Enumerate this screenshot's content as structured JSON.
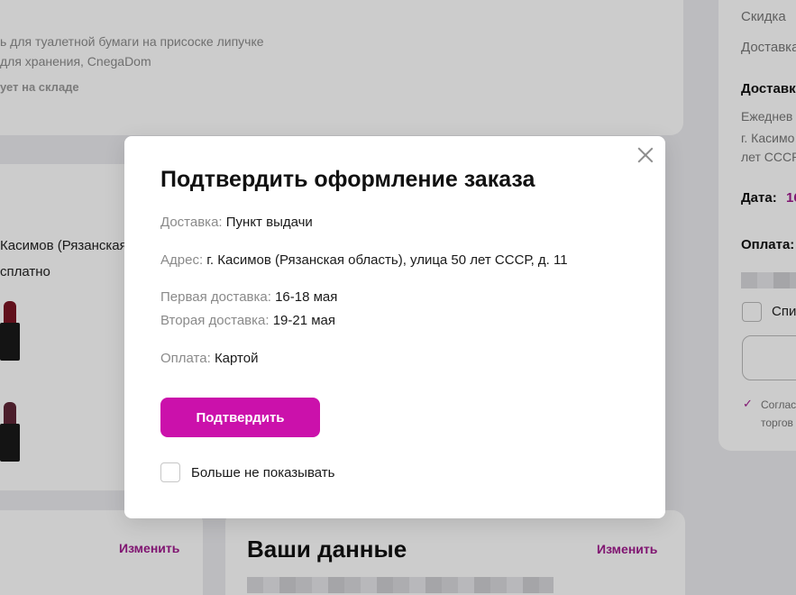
{
  "background": {
    "product": {
      "line1": "ь для туалетной бумаги на присоске липучке",
      "line2": "для хранения, CnegaDom",
      "stock": "ует на складе"
    },
    "address_fragment": "Касимов (Рязанская",
    "free_fragment": "сплатно",
    "bottom": {
      "edit_left": "Изменить",
      "your_data_title": "Ваши данные",
      "edit_right": "Изменить"
    },
    "sidebar": {
      "discount": "Скидка",
      "delivery": "Доставка",
      "delivery_heading": "Доставк",
      "daily": "Ежеднев",
      "city": "г. Касимо",
      "years": "лет СССР",
      "date_label": "Дата:",
      "date_value": "16",
      "payment_label": "Оплата:",
      "checkbox_label": "Спи",
      "tick": "✓",
      "agree": "Соглас",
      "trade": "торгов"
    }
  },
  "modal": {
    "title": "Подтвердить оформление заказа",
    "delivery": {
      "label": "Доставка:",
      "value": "Пункт выдачи"
    },
    "address": {
      "label": "Адрес:",
      "value": "г. Касимов (Рязанская область), улица 50 лет СССР, д. 11"
    },
    "first_delivery": {
      "label": "Первая доставка:",
      "value": "16-18 мая"
    },
    "second_delivery": {
      "label": "Вторая доставка:",
      "value": "19-21 мая"
    },
    "payment": {
      "label": "Оплата:",
      "value": "Картой"
    },
    "confirm_button": "Подтвердить",
    "dont_show_label": "Больше не показывать",
    "dont_show_checked": false
  },
  "colors": {
    "accent": "#cb11ab",
    "link": "#a11b8e"
  }
}
